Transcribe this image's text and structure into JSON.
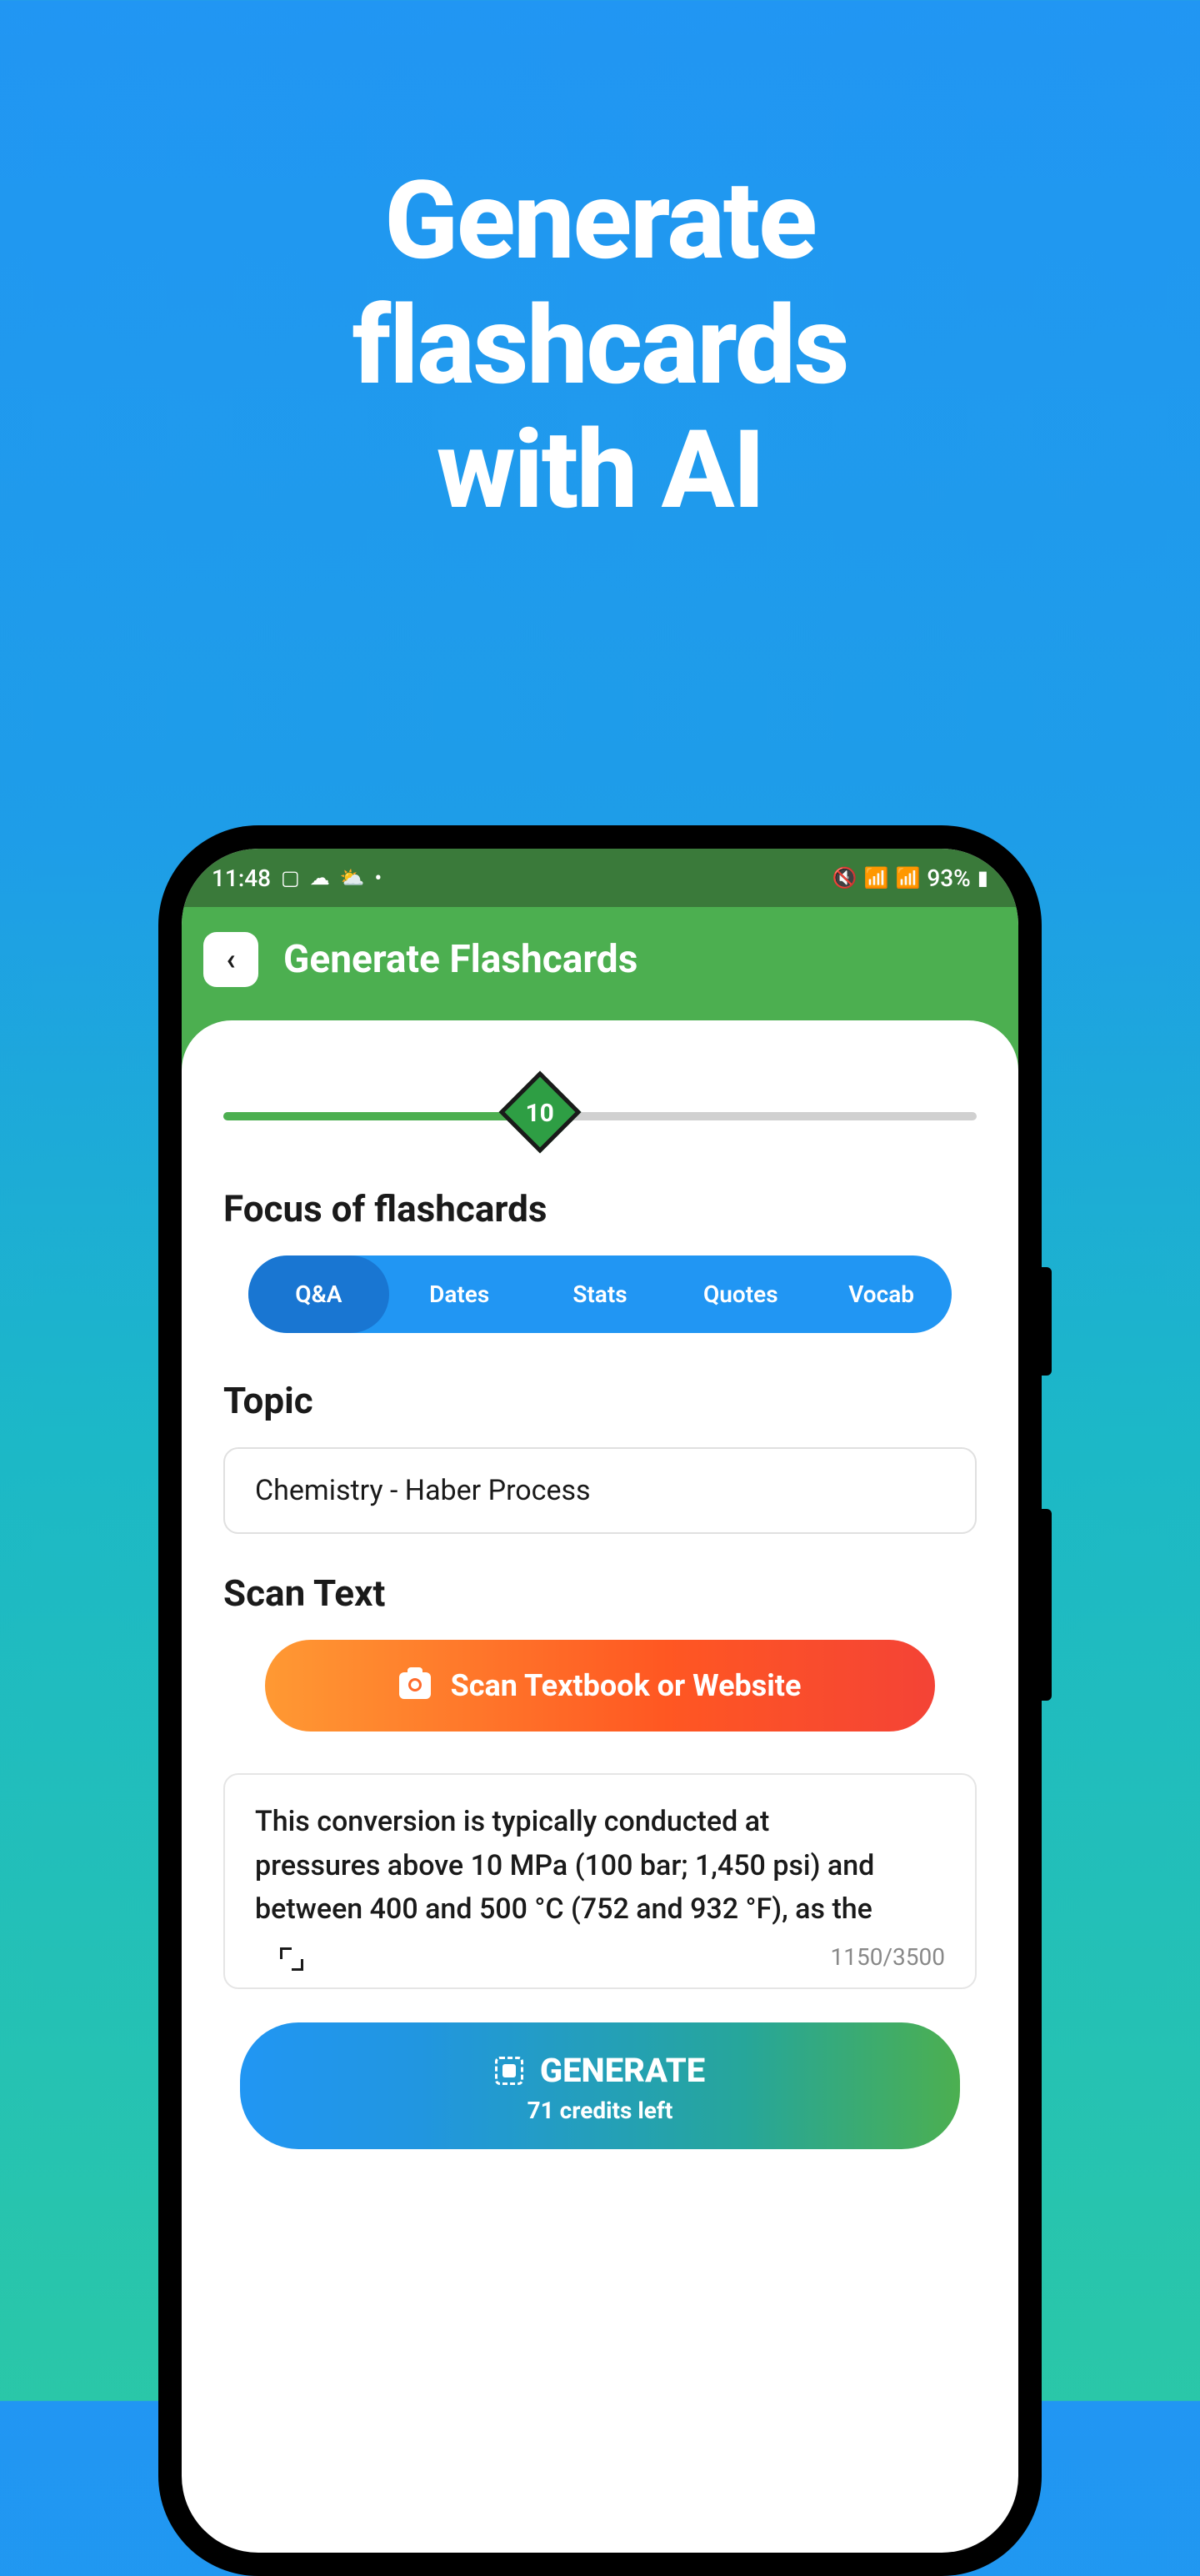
{
  "hero": {
    "line1": "Generate",
    "line2": "flashcards",
    "line3": "with AI"
  },
  "statusBar": {
    "time": "11:48",
    "battery": "93%"
  },
  "header": {
    "title": "Generate Flashcards"
  },
  "slider": {
    "value": "10"
  },
  "sections": {
    "focusTitle": "Focus of flashcards",
    "topicTitle": "Topic",
    "scanTitle": "Scan Text"
  },
  "chips": {
    "qa": "Q&A",
    "dates": "Dates",
    "stats": "Stats",
    "quotes": "Quotes",
    "vocab": "Vocab"
  },
  "topic": {
    "value": "Chemistry - Haber Process"
  },
  "scanButton": {
    "label": "Scan Textbook or Website"
  },
  "textArea": {
    "content": "This conversion is typically conducted at\npressures above 10 MPa (100 bar; 1,450 psi) and\nbetween 400 and 500 °C (752 and 932 °F), as the",
    "counter": "1150/3500"
  },
  "generateButton": {
    "label": "GENERATE",
    "credits": "71 credits left"
  }
}
